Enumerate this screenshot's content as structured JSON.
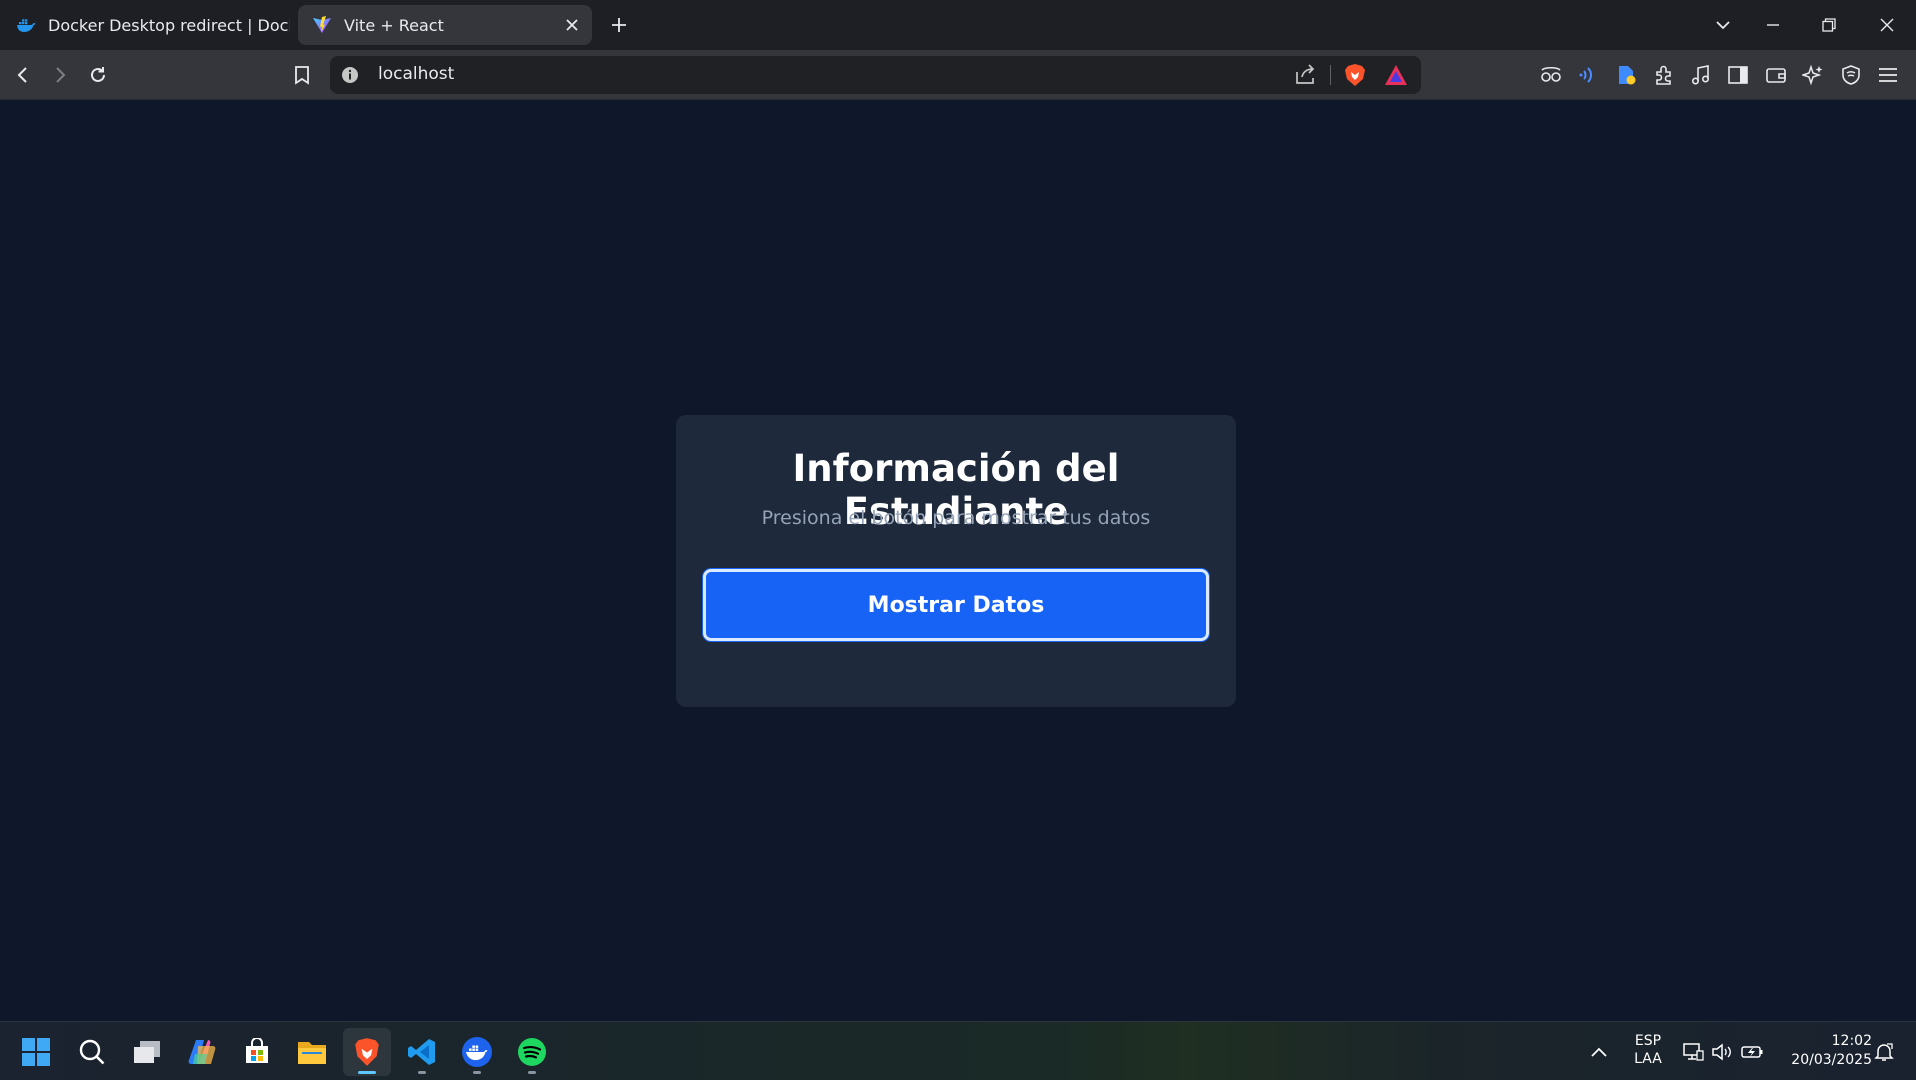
{
  "browser": {
    "tabs": [
      {
        "title": "Docker Desktop redirect | Docker",
        "favicon": "docker-icon",
        "active": false
      },
      {
        "title": "Vite + React",
        "favicon": "vite-icon",
        "active": true
      }
    ],
    "address": "localhost"
  },
  "card": {
    "title": "Información del Estudiante",
    "subtitle": "Presiona el botón para mostrar tus datos",
    "button_label": "Mostrar Datos"
  },
  "taskbar": {
    "apps": [
      "start-icon",
      "search-icon",
      "task-view-icon",
      "copilot-icon",
      "microsoft-store-icon",
      "file-explorer-icon",
      "brave-browser-icon",
      "vscode-icon",
      "docker-icon",
      "spotify-icon"
    ],
    "language": {
      "line1": "ESP",
      "line2": "LAA"
    },
    "time": "12:02",
    "date": "20/03/2025"
  },
  "colors": {
    "page_bg": "#0f172a",
    "card_bg": "#1e293b",
    "button_bg": "#1663f5",
    "subtitle": "#94a3b8"
  }
}
